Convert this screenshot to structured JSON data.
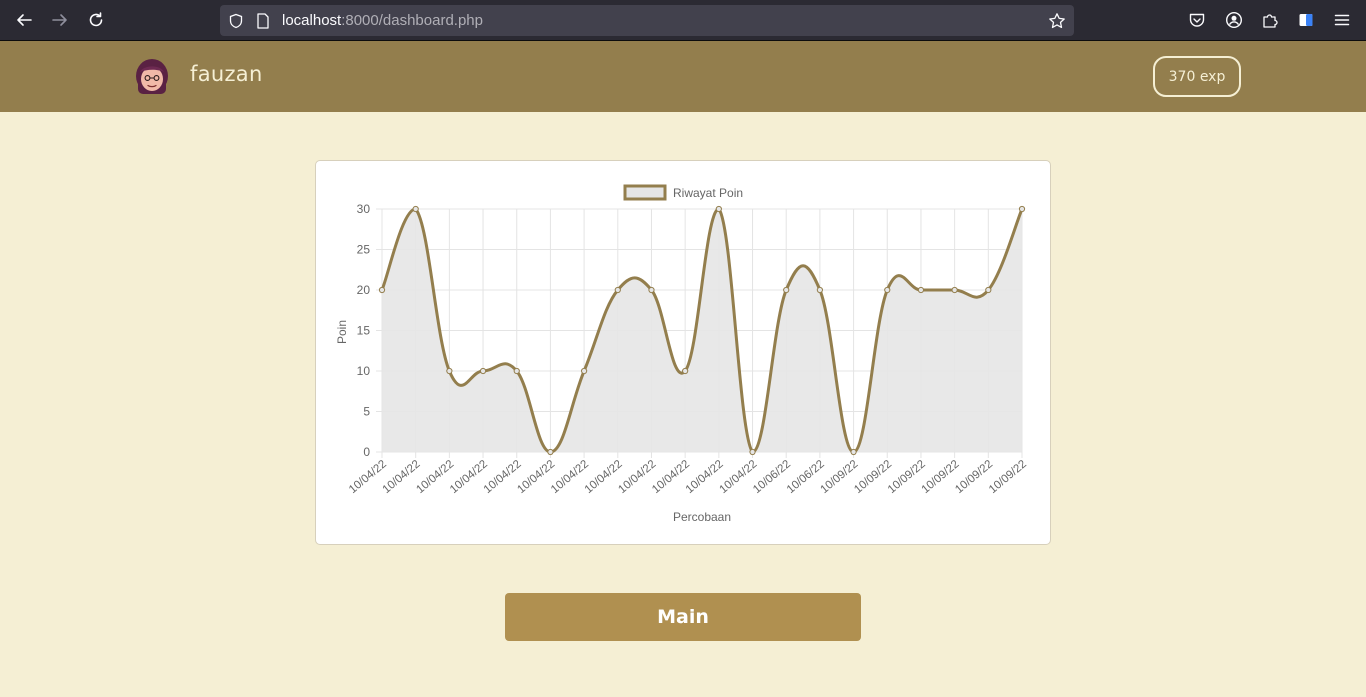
{
  "browser": {
    "url_host": "localhost",
    "url_rest": ":8000/dashboard.php"
  },
  "header": {
    "username": "fauzan",
    "exp": "370 exp"
  },
  "chart_data": {
    "type": "line",
    "fill": true,
    "legend": {
      "label": "Riwayat Poin",
      "position": "top"
    },
    "xlabel": "Percobaan",
    "ylabel": "Poin",
    "ylim": [
      0,
      30
    ],
    "yticks": [
      0,
      5,
      10,
      15,
      20,
      25,
      30
    ],
    "grid": true,
    "colors": {
      "line": "#937e4d",
      "fill": "#e5e5e5"
    },
    "categories": [
      "10/04/22",
      "10/04/22",
      "10/04/22",
      "10/04/22",
      "10/04/22",
      "10/04/22",
      "10/04/22",
      "10/04/22",
      "10/04/22",
      "10/04/22",
      "10/04/22",
      "10/04/22",
      "10/06/22",
      "10/06/22",
      "10/09/22",
      "10/09/22",
      "10/09/22",
      "10/09/22",
      "10/09/22",
      "10/09/22"
    ],
    "values": [
      20,
      30,
      10,
      10,
      10,
      0,
      10,
      20,
      20,
      10,
      30,
      0,
      20,
      20,
      0,
      20,
      20,
      20,
      20,
      30
    ]
  },
  "main_button": {
    "label": "Main"
  }
}
